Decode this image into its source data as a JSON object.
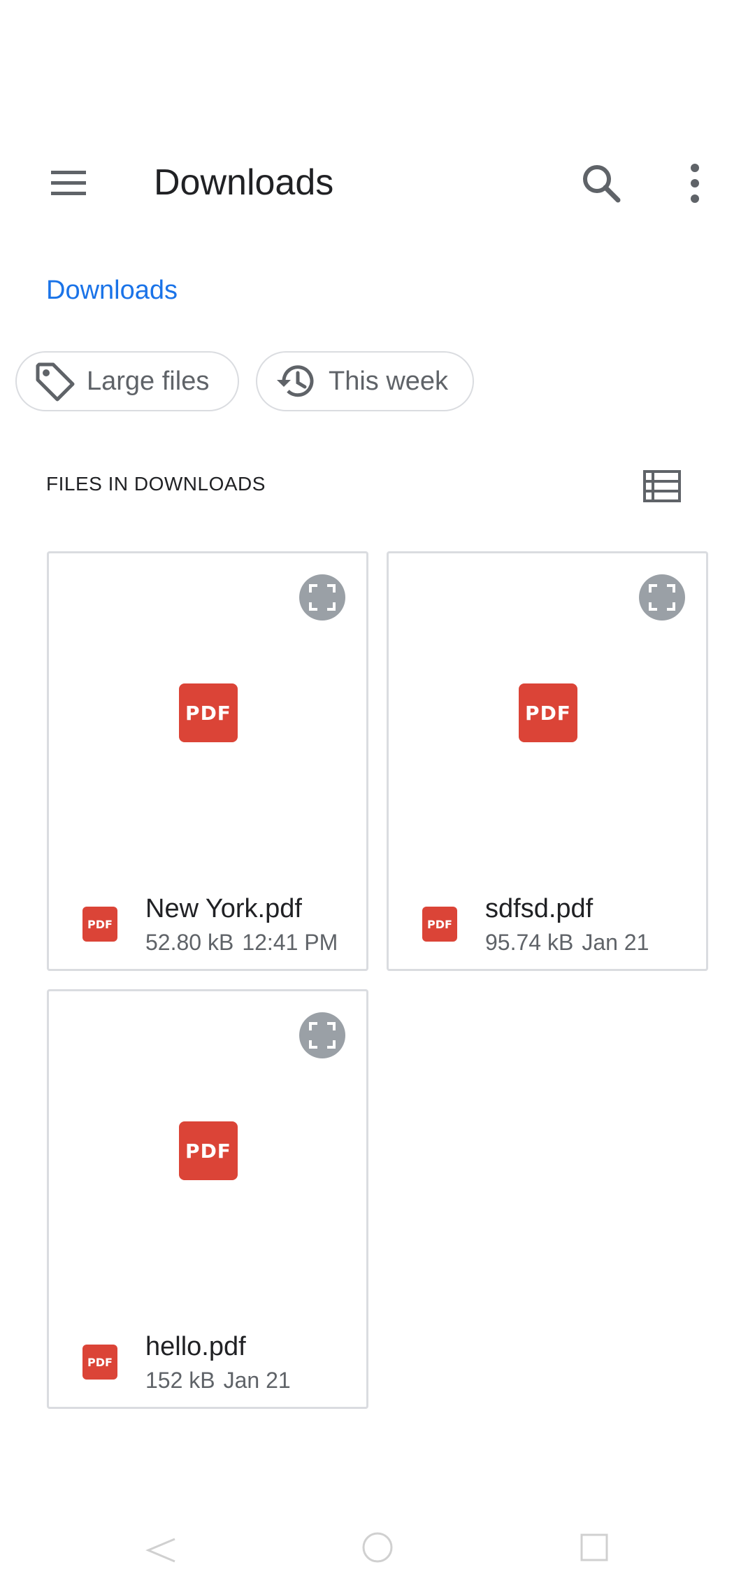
{
  "toolbar": {
    "title": "Downloads",
    "icons": {
      "menu": "menu-icon",
      "search": "search-icon",
      "more": "more-vert-icon"
    }
  },
  "breadcrumb": {
    "label": "Downloads"
  },
  "chips": [
    {
      "label": "Large files",
      "icon": "tag-icon"
    },
    {
      "label": "This week",
      "icon": "history-icon"
    }
  ],
  "section": {
    "title": "FILES IN DOWNLOADS",
    "view_icon": "list-view-icon"
  },
  "files": [
    {
      "name": "New York.pdf",
      "size": "52.80 kB",
      "date": "12:41 PM",
      "badge": "PDF"
    },
    {
      "name": "sdfsd.pdf",
      "size": "95.74 kB",
      "date": "Jan 21",
      "badge": "PDF"
    },
    {
      "name": "hello.pdf",
      "size": "152 kB",
      "date": "Jan 21",
      "badge": "PDF"
    }
  ],
  "colors": {
    "accent": "#1a73e8",
    "pdf": "#db4437",
    "border": "#dadce0"
  }
}
